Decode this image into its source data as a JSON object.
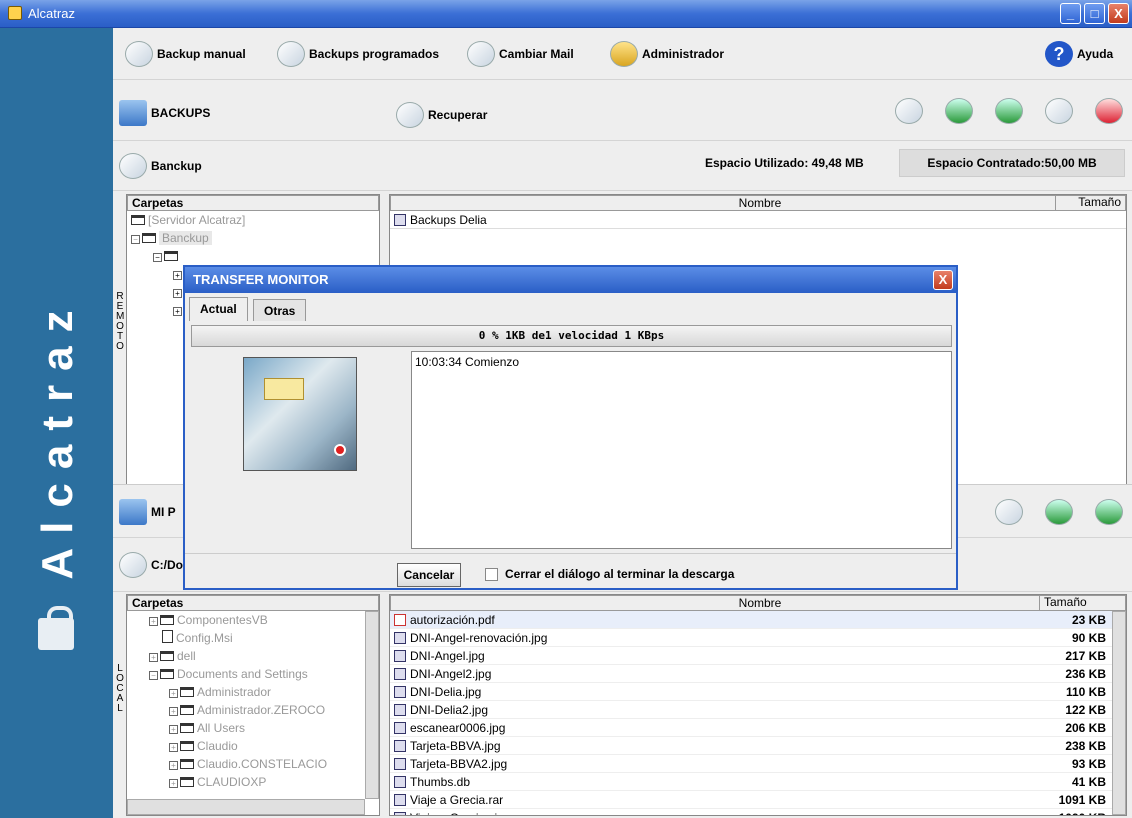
{
  "window": {
    "title": "Alcatraz",
    "minimize": "_",
    "maximize": "□",
    "close": "X"
  },
  "brand": {
    "text": "Alcatraz"
  },
  "toolbar": {
    "backup_manual": "Backup manual",
    "backups_programados": "Backups programados",
    "cambiar_mail": "Cambiar Mail",
    "administrador": "Administrador",
    "ayuda": "Ayuda"
  },
  "backups_bar": {
    "title": "BACKUPS",
    "recuperar": "Recuperar"
  },
  "remote_bar": {
    "name": "Banckup",
    "espacio_utilizado": "Espacio Utilizado: 49,48 MB",
    "espacio_contratado": "Espacio Contratado:50,00 MB"
  },
  "remote": {
    "side_label": [
      "R",
      "E",
      "M",
      "O",
      "T",
      "O"
    ],
    "folders_header": "Carpetas",
    "tree": [
      "[Servidor Alcatraz]",
      "Banckup"
    ],
    "files_header_name": "Nombre",
    "files_header_size": "Tamaño",
    "files": [
      {
        "name": "Backups Delia",
        "size": ""
      }
    ]
  },
  "local_bar": {
    "title": "MI P",
    "path": "C:/Do"
  },
  "local": {
    "side_label": [
      "L",
      "O",
      "C",
      "A",
      "L"
    ],
    "folders_header": "Carpetas",
    "tree": [
      "ComponentesVB",
      "Config.Msi",
      "dell",
      "Documents and Settings",
      "Administrador",
      "Administrador.ZEROCO",
      "All Users",
      "Claudio",
      "Claudio.CONSTELACIO",
      "CLAUDIOXP"
    ],
    "files_header_name": "Nombre",
    "files_header_size": "Tamaño",
    "files": [
      {
        "name": "autorización.pdf",
        "size": "23 KB"
      },
      {
        "name": "DNI-Angel-renovación.jpg",
        "size": "90 KB"
      },
      {
        "name": "DNI-Angel.jpg",
        "size": "217 KB"
      },
      {
        "name": "DNI-Angel2.jpg",
        "size": "236 KB"
      },
      {
        "name": "DNI-Delia.jpg",
        "size": "110 KB"
      },
      {
        "name": "DNI-Delia2.jpg",
        "size": "122 KB"
      },
      {
        "name": "escanear0006.jpg",
        "size": "206 KB"
      },
      {
        "name": "Tarjeta-BBVA.jpg",
        "size": "238 KB"
      },
      {
        "name": "Tarjeta-BBVA2.jpg",
        "size": "93 KB"
      },
      {
        "name": "Thumbs.db",
        "size": "41 KB"
      },
      {
        "name": "Viaje a Grecia.rar",
        "size": "1091 KB"
      },
      {
        "name": "Viaje a Grecia.zip",
        "size": "1090 KB"
      }
    ]
  },
  "dialog": {
    "title": "TRANSFER MONITOR",
    "close": "X",
    "tabs": [
      "Actual",
      "Otras"
    ],
    "progress": "0 % 1KB de1 velocidad 1 KBps",
    "log": "10:03:34 Comienzo",
    "cancel": "Cancelar",
    "close_on_finish": "Cerrar el diálogo al terminar la descarga"
  }
}
